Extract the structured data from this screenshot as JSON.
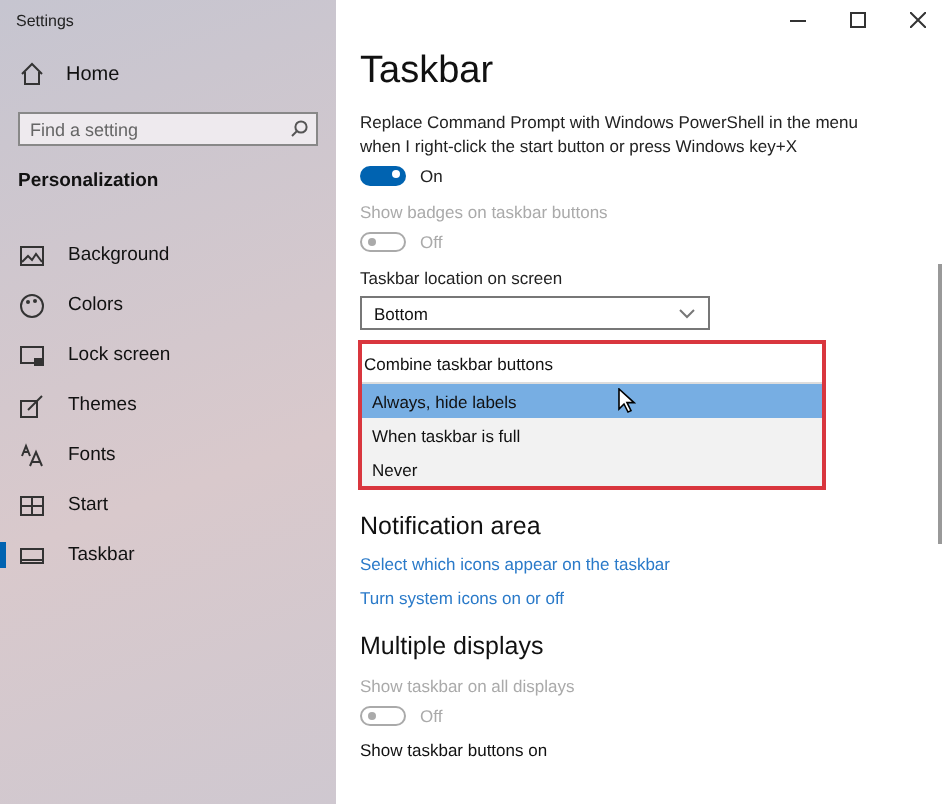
{
  "window": {
    "title": "Settings"
  },
  "sidebar": {
    "home": "Home",
    "search": {
      "placeholder": "Find a setting"
    },
    "section": "Personalization",
    "items": [
      {
        "label": "Background",
        "selected": false
      },
      {
        "label": "Colors",
        "selected": false
      },
      {
        "label": "Lock screen",
        "selected": false
      },
      {
        "label": "Themes",
        "selected": false
      },
      {
        "label": "Fonts",
        "selected": false
      },
      {
        "label": "Start",
        "selected": false
      },
      {
        "label": "Taskbar",
        "selected": true
      }
    ]
  },
  "page": {
    "title": "Taskbar",
    "settings": [
      {
        "kind": "toggle",
        "label": "Replace Command Prompt with Windows PowerShell in the menu when I right-click the start button or press Windows key+X",
        "on": true,
        "state_text": "On",
        "disabled": false
      },
      {
        "kind": "toggle",
        "label": "Show badges on taskbar buttons",
        "on": false,
        "state_text": "Off",
        "disabled": true
      },
      {
        "kind": "dropdown",
        "label": "Taskbar location on screen",
        "value": "Bottom"
      },
      {
        "kind": "list",
        "label": "Combine taskbar buttons",
        "highlighted": true,
        "options": [
          {
            "label": "Always, hide labels",
            "selected": true
          },
          {
            "label": "When taskbar is full",
            "selected": false
          },
          {
            "label": "Never",
            "selected": false
          }
        ]
      },
      {
        "kind": "heading",
        "label": "Notification area"
      },
      {
        "kind": "link",
        "label": "Select which icons appear on the taskbar"
      },
      {
        "kind": "link",
        "label": "Turn system icons on or off"
      },
      {
        "kind": "heading",
        "label": "Multiple displays"
      },
      {
        "kind": "toggle",
        "label": "Show taskbar on all displays",
        "on": false,
        "state_text": "Off",
        "disabled": true
      },
      {
        "kind": "label",
        "label": "Show taskbar buttons on"
      }
    ]
  }
}
